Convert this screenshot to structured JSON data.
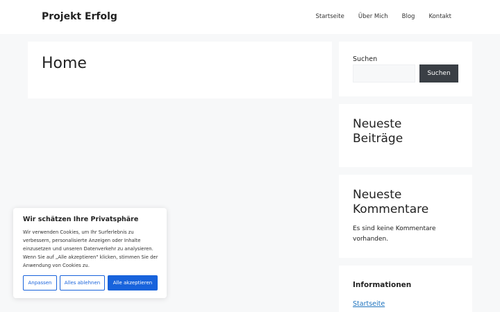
{
  "header": {
    "site_title": "Projekt Erfolg",
    "nav": [
      "Startseite",
      "Über Mich",
      "Blog",
      "Kontakt"
    ]
  },
  "main": {
    "page_title": "Home"
  },
  "sidebar": {
    "search": {
      "label": "Suchen",
      "button": "Suchen",
      "value": ""
    },
    "recent_posts": {
      "title": "Neueste Beiträge"
    },
    "recent_comments": {
      "title": "Neueste Kommentare",
      "text": "Es sind keine Kommentare vorhanden."
    },
    "info": {
      "title": "Informationen",
      "link": "Startseite"
    }
  },
  "cookie": {
    "title": "Wir schätzen Ihre Privatsphäre",
    "text": "Wir verwenden Cookies, um Ihr Surferlebnis zu verbessern, personalisierte Anzeigen oder Inhalte einzusetzen und unseren Datenverkehr zu analysieren. Wenn Sie auf „Alle akzeptieren\" klicken, stimmen Sie der Anwendung von Cookies zu.",
    "btn_customize": "Anpassen",
    "btn_reject": "Alles ablehnen",
    "btn_accept": "Alle akzeptieren"
  }
}
